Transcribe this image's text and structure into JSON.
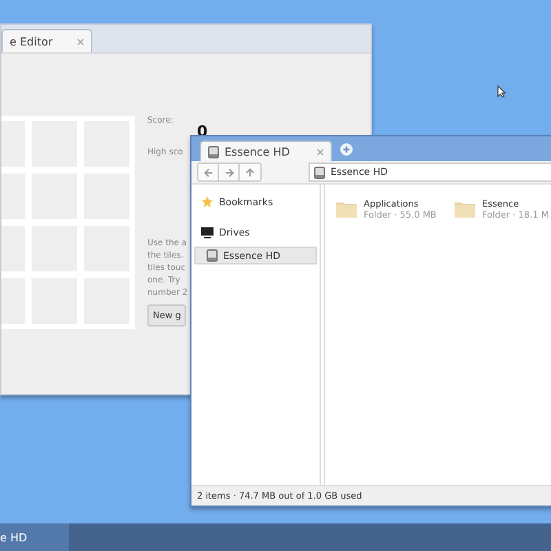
{
  "game_window": {
    "tab": {
      "label": "e Editor",
      "selected": true
    },
    "score_label": "Score:",
    "score": "0",
    "high_score_label": "High sco",
    "instructions": [
      "Use the a",
      "the tiles.",
      "tiles touc",
      "one. Try",
      "number 2"
    ],
    "new_game_button": "New g"
  },
  "file_window": {
    "tab": {
      "label": "Essence HD",
      "selected": true
    },
    "address": "Essence HD",
    "sidebar": [
      {
        "kind": "bookmarks",
        "label": "Bookmarks"
      },
      {
        "kind": "heading",
        "label": "Drives"
      },
      {
        "kind": "drive",
        "label": "Essence HD",
        "selected": true
      }
    ],
    "folders": [
      {
        "name": "Applications",
        "detail": "Folder · 55.0 MB"
      },
      {
        "name": "Essence",
        "detail": "Folder · 18.1 M"
      }
    ],
    "status_bar": "2 items · 74.7 MB out of 1.0 GB used"
  },
  "taskbar": {
    "items": [
      {
        "label": "e HD",
        "selected": true
      }
    ]
  }
}
